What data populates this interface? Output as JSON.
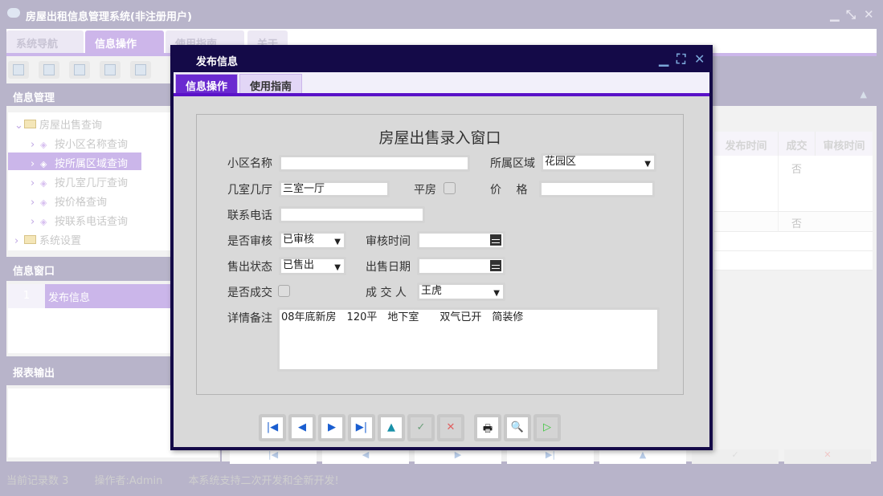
{
  "app": {
    "title": "房屋出租信息管理系统(非注册用户)"
  },
  "main_tabs": [
    "系统导航",
    "信息操作",
    "使用指南",
    "关于"
  ],
  "left": {
    "info_mgmt": "信息管理",
    "tree": [
      {
        "label": "房屋出售查询"
      },
      {
        "label": "按小区名称查询"
      },
      {
        "label": "按所属区域查询"
      },
      {
        "label": "按几室几厅查询"
      },
      {
        "label": "按价格查询"
      },
      {
        "label": "按联系电话查询"
      },
      {
        "label": "系统设置"
      }
    ],
    "info_window": "信息窗口",
    "window_list": [
      {
        "num": "1",
        "label": "发布信息"
      }
    ],
    "report": "报表输出"
  },
  "grid": {
    "headers": [
      "发布时间",
      "成交",
      "审核时间"
    ],
    "rows": [
      {
        "deal": "否"
      },
      {
        "deal": "否"
      }
    ]
  },
  "status": {
    "records": "当前记录数 3",
    "operator": "操作者:Admin",
    "notice": "本系统支持二次开发和全新开发!"
  },
  "dialog": {
    "title": "发布信息",
    "tabs": [
      "信息操作",
      "使用指南"
    ],
    "form_title": "房屋出售录入窗口",
    "labels": {
      "community": "小区名称",
      "district": "所属区域",
      "rooms": "几室几厅",
      "bungalow": "平房",
      "price": "价　 格",
      "phone": "联系电话",
      "audited": "是否审核",
      "audit_time": "审核时间",
      "sale_status": "售出状态",
      "sale_date": "出售日期",
      "dealt": "是否成交",
      "dealer": "成 交 人",
      "notes": "详情备注"
    },
    "values": {
      "community": "",
      "district": "花园区",
      "rooms": "三室一厅",
      "price": "",
      "phone": "",
      "audited": "已审核",
      "audit_time": "",
      "sale_status": "已售出",
      "sale_date": "",
      "dealer": "王虎",
      "notes": "08年底新房　120平　地下室　　双气已开　简装修"
    }
  }
}
